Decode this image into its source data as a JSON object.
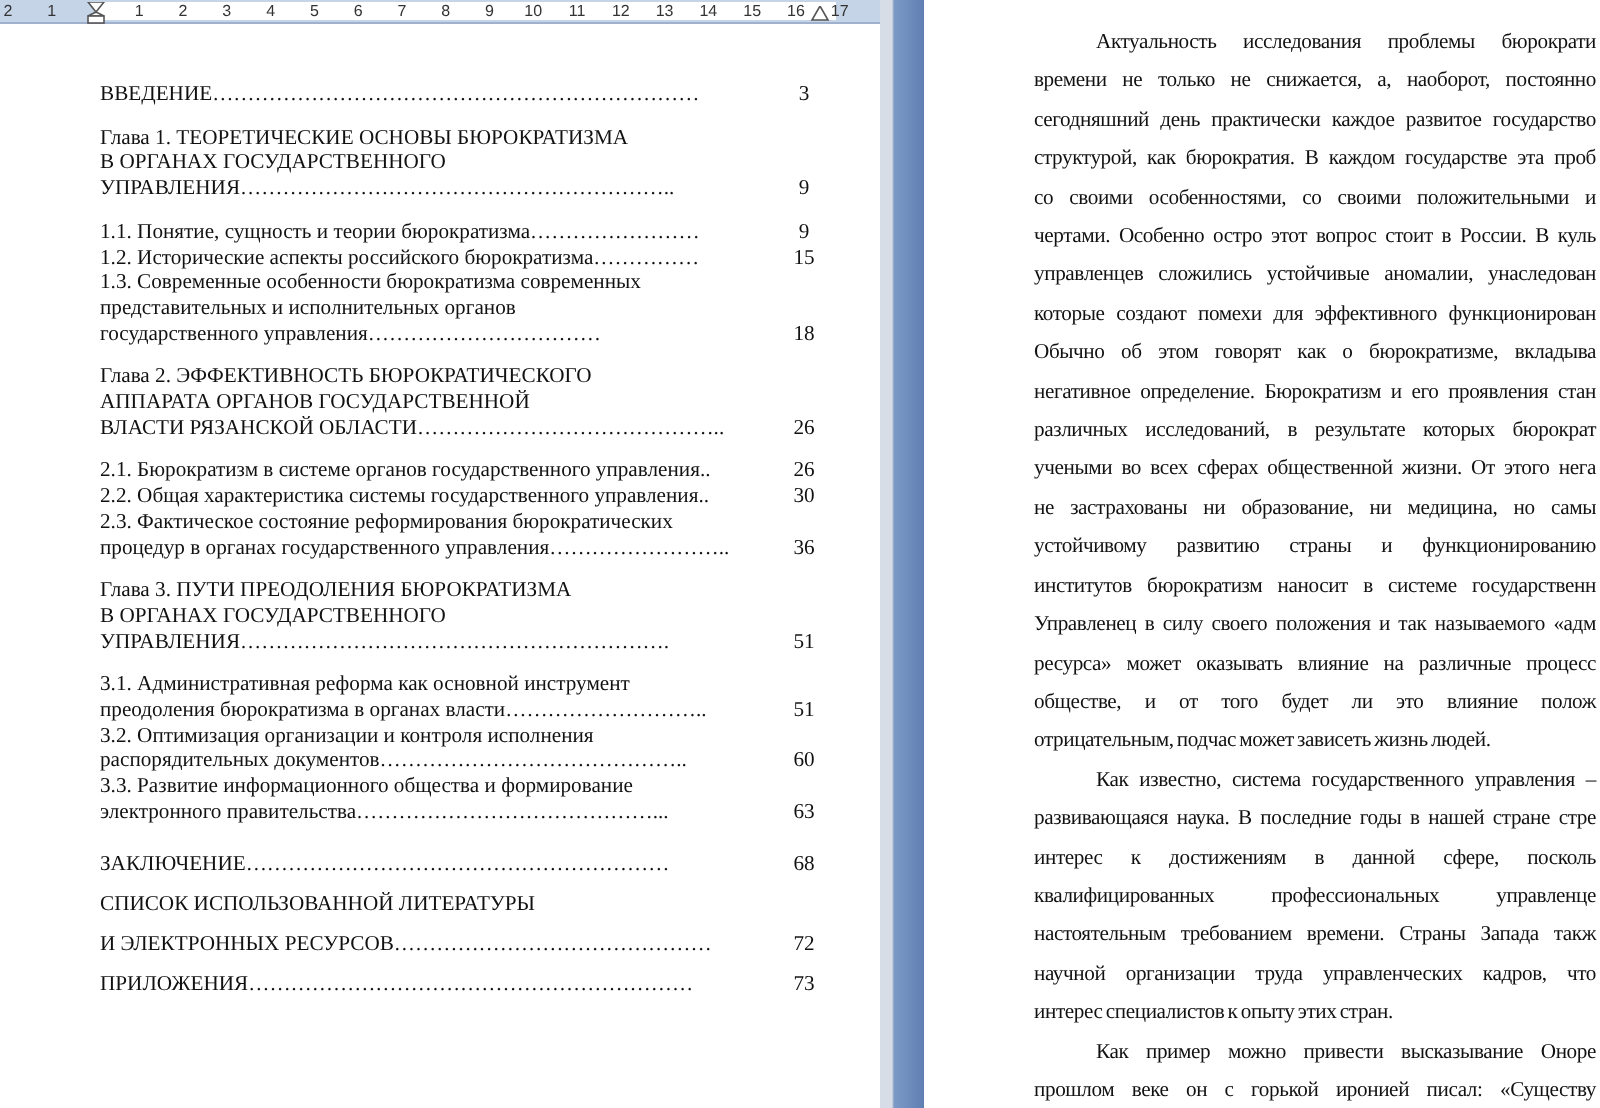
{
  "ruler": {
    "left_numbers": [
      "2",
      "1"
    ],
    "numbers": [
      "1",
      "2",
      "3",
      "4",
      "5",
      "6",
      "7",
      "8",
      "9",
      "10",
      "11",
      "12",
      "13",
      "14",
      "15",
      "16"
    ],
    "right_numbers": [
      "17"
    ]
  },
  "toc_groups": [
    {
      "kind": "compact",
      "entries": [
        {
          "lines": [
            "ВВЕДЕНИЕ……………………………………………………………"
          ],
          "page": "3"
        }
      ]
    },
    {
      "kind": "compact",
      "entries": [
        {
          "lines": [
            "Глава 1. ТЕОРЕТИЧЕСКИЕ ОСНОВЫ БЮРОКРАТИЗМА",
            "В ОРГАНАХ ГОСУДАРСТВЕННОГО",
            "УПРАВЛЕНИЯ…………………………………………………….."
          ],
          "page": "9"
        }
      ]
    },
    {
      "kind": "compact",
      "entries": [
        {
          "lines": [
            "1.1.    Понятие, сущность и теории бюрократизма……………………"
          ],
          "page": "9"
        },
        {
          "lines": [
            "1.2.    Исторические аспекты российского бюрократизма……………"
          ],
          "page": "15"
        },
        {
          "lines": [
            "1.3.    Современные особенности бюрократизма современных",
            "представительных и исполнительных органов",
            "государственного управления……………………………"
          ],
          "page": "18"
        }
      ]
    },
    {
      "kind": "compact",
      "entries": [
        {
          "lines": [
            "Глава 2. ЭФФЕКТИВНОСТЬ БЮРОКРАТИЧЕСКОГО",
            "АППАРАТА  ОРГАНОВ ГОСУДАРСТВЕННОЙ",
            "ВЛАСТИ РЯЗАНСКОЙ ОБЛАСТИ…………………………………….."
          ],
          "page": "26"
        }
      ]
    },
    {
      "kind": "compact",
      "entries": [
        {
          "lines": [
            "2.1. Бюрократизм в системе органов государственного управления.."
          ],
          "page": "26"
        },
        {
          "lines": [
            "2.2. Общая характеристика системы государственного управления.."
          ],
          "page": "30"
        },
        {
          "lines": [
            "2.3. Фактическое состояние реформирования бюрократических",
            "процедур в органах государственного управления…………………….."
          ],
          "page": "36"
        }
      ]
    },
    {
      "kind": "compact",
      "entries": [
        {
          "lines": [
            "Глава 3. ПУТИ ПРЕОДОЛЕНИЯ  БЮРОКРАТИЗМА",
            "В ОРГАНАХ ГОСУДАРСТВЕННОГО",
            "УПРАВЛЕНИЯ……………………………………………………."
          ],
          "page": "51"
        }
      ]
    },
    {
      "kind": "compact",
      "entries": [
        {
          "lines": [
            "3.1. Административная реформа как основной инструмент",
            "преодоления бюрократизма в органах власти……………………….."
          ],
          "page": "51"
        },
        {
          "lines": [
            "3.2. Оптимизация организации и контроля исполнения",
            "распорядительных документов…………………………………….."
          ],
          "page": "60"
        },
        {
          "lines": [
            "3.3. Развитие информационного общества и формирование",
            "электронного правительства……………………………………..."
          ],
          "page": "63"
        }
      ]
    },
    {
      "kind": "spaced",
      "entries": [
        {
          "lines": [
            "ЗАКЛЮЧЕНИЕ……………………………………………………"
          ],
          "page": "68"
        },
        {
          "lines": [
            "СПИСОК ИСПОЛЬЗОВАННОЙ ЛИТЕРАТУРЫ",
            "И ЭЛЕКТРОННЫХ РЕСУРСОВ………………………………………"
          ],
          "page": "72"
        },
        {
          "lines": [
            "ПРИЛОЖЕНИЯ………………………………………………………"
          ],
          "page": "73"
        }
      ]
    }
  ],
  "body_lines": [
    {
      "kind": "indent",
      "text": "Актуальность исследования проблемы бюрократи"
    },
    {
      "kind": "body",
      "text": "времени не только не снижается, а, наоборот, постоянно"
    },
    {
      "kind": "body",
      "text": "сегодняшний день практически каждое развитое государство"
    },
    {
      "kind": "body",
      "text": "структурой, как бюрократия. В каждом государстве эта проб"
    },
    {
      "kind": "body",
      "text": "со своими особенностями, со своими положительными и"
    },
    {
      "kind": "body",
      "text": "чертами. Особенно остро этот вопрос стоит в России. В куль"
    },
    {
      "kind": "body",
      "text": "управленцев сложились устойчивые аномалии, унаследован"
    },
    {
      "kind": "body",
      "text": "которые создают помехи для эффективного функционирован"
    },
    {
      "kind": "body",
      "text": "Обычно об этом говорят как о бюрократизме, вкладыва"
    },
    {
      "kind": "body",
      "text": "негативное определение. Бюрократизм и его проявления стан"
    },
    {
      "kind": "body",
      "text": "различных исследований, в результате которых бюрократ"
    },
    {
      "kind": "body",
      "text": "учеными во всех сферах общественной жизни. От этого нега"
    },
    {
      "kind": "body",
      "text": "не застрахованы ни образование, ни медицина, но самы"
    },
    {
      "kind": "body",
      "text": "устойчивому развитию страны и функционированию"
    },
    {
      "kind": "body",
      "text": "институтов бюрократизм наносит в системе государственн"
    },
    {
      "kind": "body",
      "text": "Управленец в силу своего положения и так называемого «адм"
    },
    {
      "kind": "body",
      "text": "ресурса» может оказывать влияние на различные процесс"
    },
    {
      "kind": "body",
      "text": "обществе, и от того будет ли это влияние полож"
    },
    {
      "kind": "end",
      "text": "отрицательным, подчас может зависеть жизнь людей."
    },
    {
      "kind": "indent",
      "text": "Как известно, система государственного управления –"
    },
    {
      "kind": "body",
      "text": "развивающаяся наука. В последние годы в нашей стране стре"
    },
    {
      "kind": "body",
      "text": "интерес к достижениям в данной сфере, посколь"
    },
    {
      "kind": "body",
      "text": "квалифицированных профессиональных управленце"
    },
    {
      "kind": "body",
      "text": "настоятельным требованием времени. Страны Запада такж"
    },
    {
      "kind": "body",
      "text": "научной организации труда управленческих кадров, что"
    },
    {
      "kind": "end",
      "text": "интерес специалистов к опыту этих стран."
    },
    {
      "kind": "indent",
      "text": "Как пример можно привести высказывание Оноре"
    },
    {
      "kind": "body",
      "text": "прошлом веке он с горькой иронией писал: «Существу"
    }
  ]
}
